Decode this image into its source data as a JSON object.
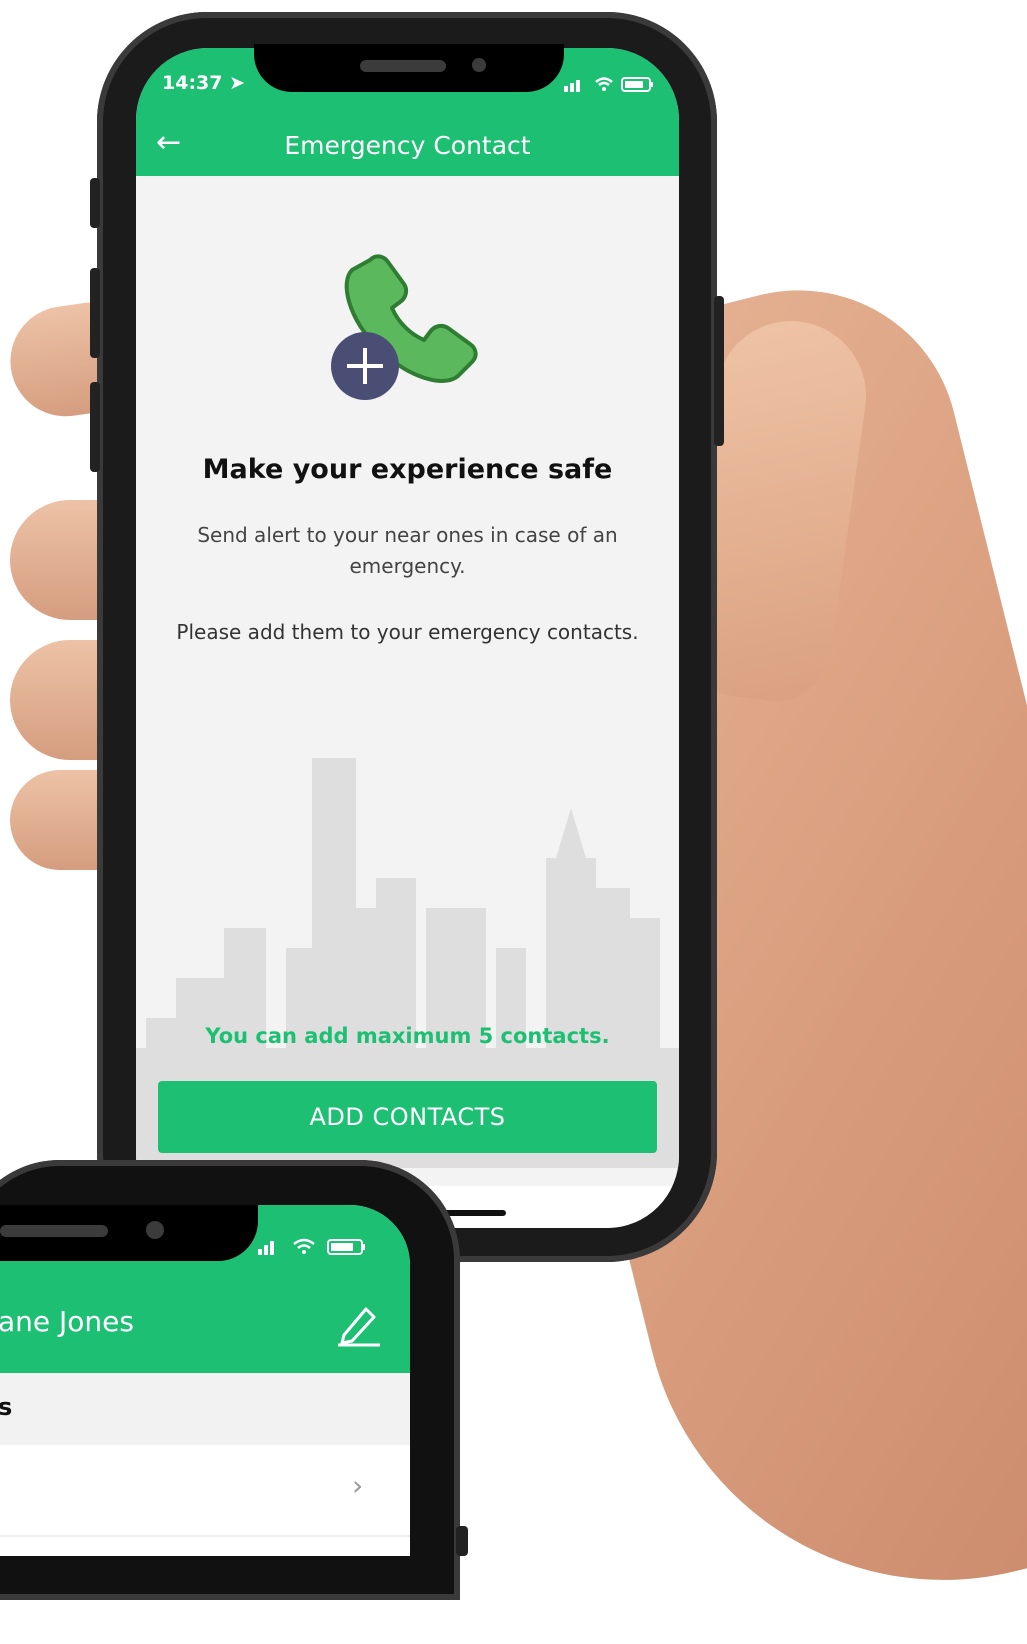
{
  "main_phone": {
    "status_bar": {
      "time": "14:37"
    },
    "app_bar": {
      "title": "Emergency Contact"
    },
    "content": {
      "headline": "Make your experience safe",
      "description": "Send alert to your near ones in case of an emergency.",
      "instruction": "Please add them to your emergency contacts.",
      "limit_note": "You can add maximum 5 contacts.",
      "add_button": "ADD CONTACTS"
    }
  },
  "second_phone": {
    "app_bar": {
      "name": "ane Jones"
    },
    "section_label": "s",
    "row_chevron": "›"
  },
  "colors": {
    "brand_green": "#1dbf73",
    "phone_icon_green": "#5cb85c",
    "plus_badge": "#4a4e74"
  },
  "icons": [
    "back-arrow-icon",
    "location-arrow-icon",
    "signal-icon",
    "wifi-icon",
    "battery-icon",
    "phone-add-icon",
    "edit-pencil-icon",
    "chevron-right-icon"
  ]
}
